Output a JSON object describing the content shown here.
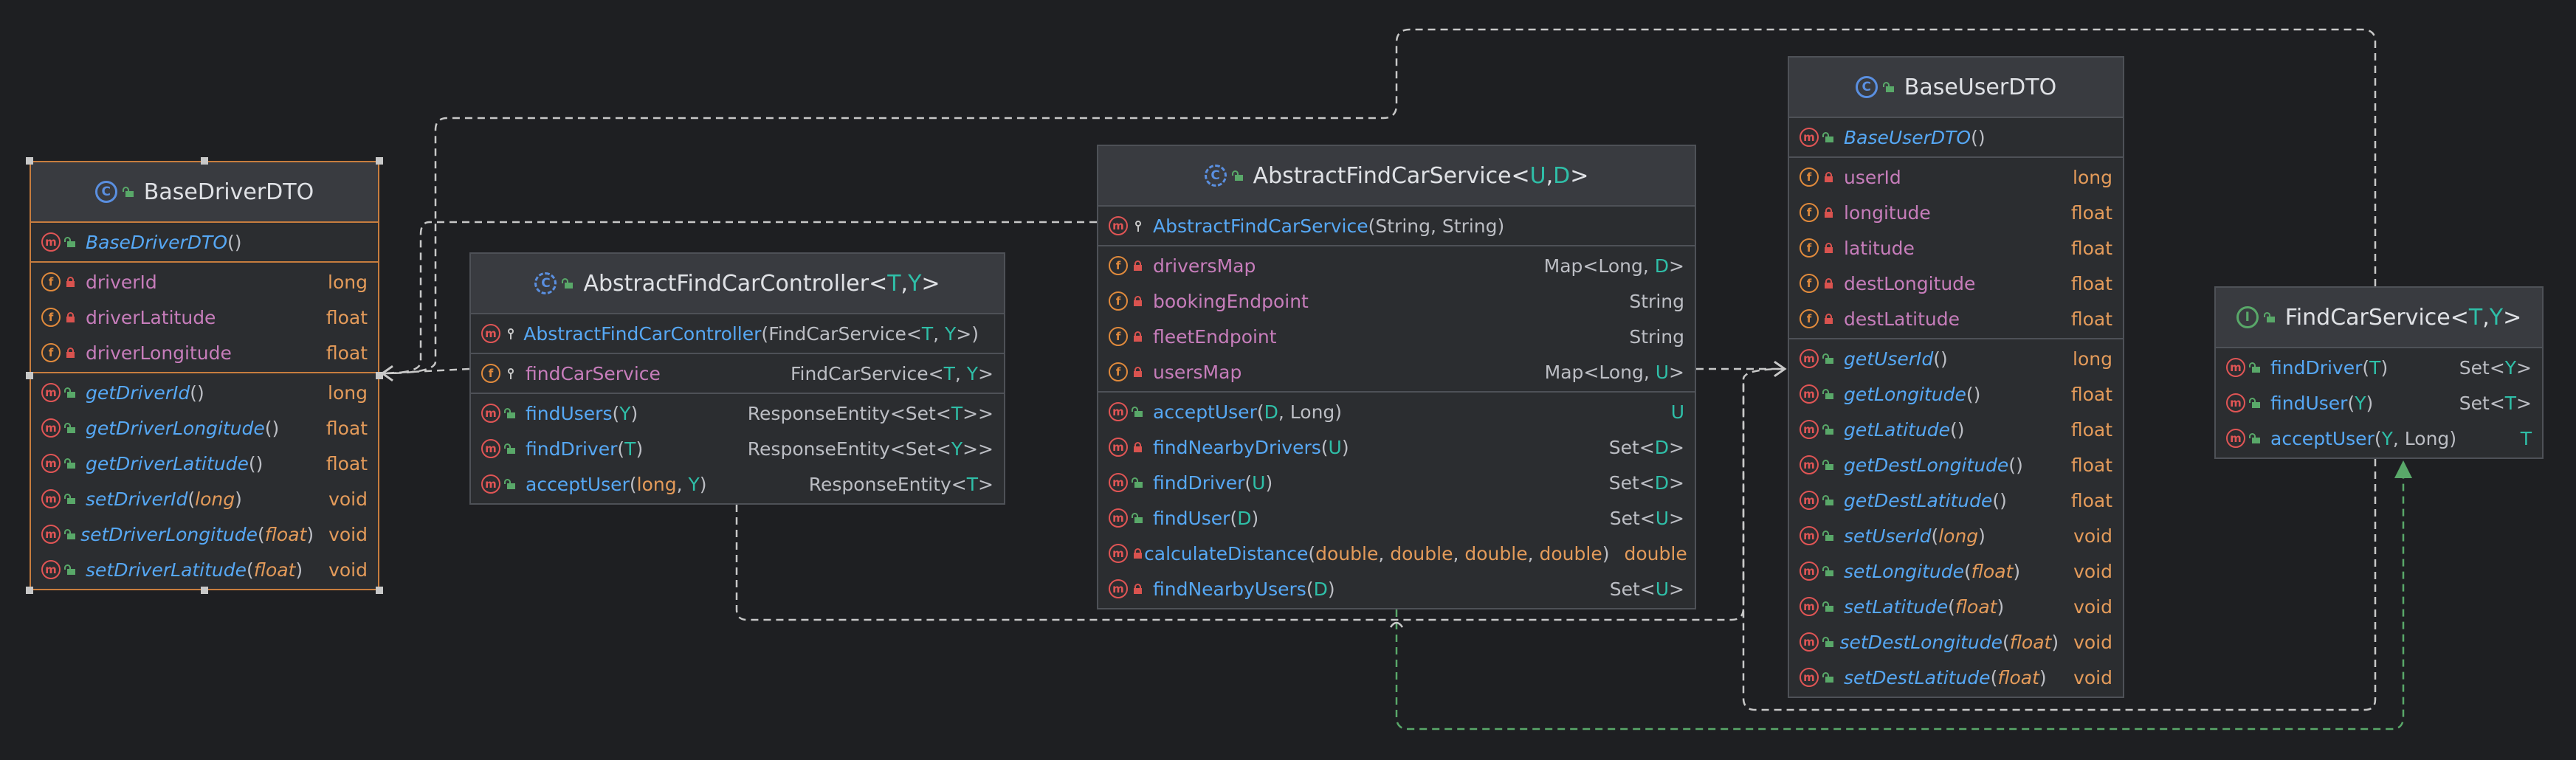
{
  "classes": [
    {
      "id": "BaseDriverDTO",
      "kind": "C",
      "abstract": false,
      "name": "BaseDriverDTO",
      "type_params": [],
      "selected": true,
      "sections": [
        [
          {
            "k": "m",
            "vis": "pub",
            "name": "BaseDriverDTO",
            "style": "ital",
            "params": [],
            "type": ""
          }
        ],
        [
          {
            "k": "f",
            "vis": "priv",
            "name": "driverId",
            "type": "long",
            "prim": true
          },
          {
            "k": "f",
            "vis": "priv",
            "name": "driverLatitude",
            "type": "float",
            "prim": true
          },
          {
            "k": "f",
            "vis": "priv",
            "name": "driverLongitude",
            "type": "float",
            "prim": true
          }
        ],
        [
          {
            "k": "m",
            "vis": "pub",
            "name": "getDriverId",
            "style": "ital",
            "params": [],
            "type": "long",
            "prim": true
          },
          {
            "k": "m",
            "vis": "pub",
            "name": "getDriverLongitude",
            "style": "ital",
            "params": [],
            "type": "float",
            "prim": true
          },
          {
            "k": "m",
            "vis": "pub",
            "name": "getDriverLatitude",
            "style": "ital",
            "params": [],
            "type": "float",
            "prim": true
          },
          {
            "k": "m",
            "vis": "pub",
            "name": "setDriverId",
            "style": "ital",
            "params": [
              {
                "t": "long",
                "c": "pi"
              }
            ],
            "type": "void",
            "prim": true
          },
          {
            "k": "m",
            "vis": "pub",
            "name": "setDriverLongitude",
            "style": "ital",
            "params": [
              {
                "t": "float",
                "c": "pi"
              }
            ],
            "type": "void",
            "prim": true
          },
          {
            "k": "m",
            "vis": "pub",
            "name": "setDriverLatitude",
            "style": "ital",
            "params": [
              {
                "t": "float",
                "c": "pi"
              }
            ],
            "type": "void",
            "prim": true
          }
        ]
      ]
    },
    {
      "id": "AbstractFindCarController",
      "kind": "C",
      "abstract": true,
      "name": "AbstractFindCarController",
      "type_params": [
        "T",
        "Y"
      ],
      "selected": false,
      "sections": [
        [
          {
            "k": "m",
            "vis": "pkg",
            "name": "AbstractFindCarController",
            "params": [
              {
                "t": "FindCarService<",
                "c": "n"
              },
              {
                "t": "T",
                "c": "t"
              },
              {
                "t": ", ",
                "c": "n"
              },
              {
                "t": "Y",
                "c": "t"
              },
              {
                "t": ">",
                "c": "n"
              }
            ],
            "type": ""
          }
        ],
        [
          {
            "k": "f",
            "vis": "pkg",
            "name": "findCarService",
            "type": "",
            "type_rich": [
              {
                "t": "FindCarService<",
                "c": "n"
              },
              {
                "t": "T",
                "c": "t"
              },
              {
                "t": ", ",
                "c": "n"
              },
              {
                "t": "Y",
                "c": "t"
              },
              {
                "t": ">",
                "c": "n"
              }
            ]
          }
        ],
        [
          {
            "k": "m",
            "vis": "pub",
            "name": "findUsers",
            "params": [
              {
                "t": "Y",
                "c": "t"
              }
            ],
            "type": "",
            "type_rich": [
              {
                "t": "ResponseEntity<Set<",
                "c": "n"
              },
              {
                "t": "T",
                "c": "t"
              },
              {
                "t": ">>",
                "c": "n"
              }
            ]
          },
          {
            "k": "m",
            "vis": "pub",
            "name": "findDriver",
            "params": [
              {
                "t": "T",
                "c": "t"
              }
            ],
            "type": "",
            "type_rich": [
              {
                "t": "ResponseEntity<Set<",
                "c": "n"
              },
              {
                "t": "Y",
                "c": "t"
              },
              {
                "t": ">>",
                "c": "n"
              }
            ]
          },
          {
            "k": "m",
            "vis": "pub",
            "name": "acceptUser",
            "params": [
              {
                "t": "long",
                "c": "p"
              },
              {
                "t": ", ",
                "c": "n"
              },
              {
                "t": "Y",
                "c": "t"
              }
            ],
            "type": "",
            "type_rich": [
              {
                "t": "ResponseEntity<",
                "c": "n"
              },
              {
                "t": "T",
                "c": "t"
              },
              {
                "t": ">",
                "c": "n"
              }
            ]
          }
        ]
      ]
    },
    {
      "id": "AbstractFindCarService",
      "kind": "C",
      "abstract": true,
      "name": "AbstractFindCarService",
      "type_params": [
        "U",
        "D"
      ],
      "selected": false,
      "sections": [
        [
          {
            "k": "m",
            "vis": "pkg",
            "name": "AbstractFindCarService",
            "params": [
              {
                "t": "String, String",
                "c": "n"
              }
            ],
            "type": ""
          }
        ],
        [
          {
            "k": "f",
            "vis": "priv",
            "name": "driversMap",
            "type": "",
            "type_rich": [
              {
                "t": "Map<Long, ",
                "c": "n"
              },
              {
                "t": "D",
                "c": "t"
              },
              {
                "t": ">",
                "c": "n"
              }
            ]
          },
          {
            "k": "f",
            "vis": "priv",
            "name": "bookingEndpoint",
            "type": "String"
          },
          {
            "k": "f",
            "vis": "priv",
            "name": "fleetEndpoint",
            "type": "String"
          },
          {
            "k": "f",
            "vis": "priv",
            "name": "usersMap",
            "type": "",
            "type_rich": [
              {
                "t": "Map<Long, ",
                "c": "n"
              },
              {
                "t": "U",
                "c": "t"
              },
              {
                "t": ">",
                "c": "n"
              }
            ]
          }
        ],
        [
          {
            "k": "m",
            "vis": "pub",
            "name": "acceptUser",
            "params": [
              {
                "t": "D",
                "c": "t"
              },
              {
                "t": ", Long",
                "c": "n"
              }
            ],
            "type": "U",
            "tv": true
          },
          {
            "k": "m",
            "vis": "priv",
            "name": "findNearbyDrivers",
            "params": [
              {
                "t": "U",
                "c": "t"
              }
            ],
            "type": "",
            "type_rich": [
              {
                "t": "Set<",
                "c": "n"
              },
              {
                "t": "D",
                "c": "t"
              },
              {
                "t": ">",
                "c": "n"
              }
            ]
          },
          {
            "k": "m",
            "vis": "pub",
            "name": "findDriver",
            "params": [
              {
                "t": "U",
                "c": "t"
              }
            ],
            "type": "",
            "type_rich": [
              {
                "t": "Set<",
                "c": "n"
              },
              {
                "t": "D",
                "c": "t"
              },
              {
                "t": ">",
                "c": "n"
              }
            ]
          },
          {
            "k": "m",
            "vis": "pub",
            "name": "findUser",
            "params": [
              {
                "t": "D",
                "c": "t"
              }
            ],
            "type": "",
            "type_rich": [
              {
                "t": "Set<",
                "c": "n"
              },
              {
                "t": "U",
                "c": "t"
              },
              {
                "t": ">",
                "c": "n"
              }
            ]
          },
          {
            "k": "m",
            "vis": "priv",
            "name": "calculateDistance",
            "params": [
              {
                "t": "double",
                "c": "p"
              },
              {
                "t": ", ",
                "c": "n"
              },
              {
                "t": "double",
                "c": "p"
              },
              {
                "t": ", ",
                "c": "n"
              },
              {
                "t": "double",
                "c": "p"
              },
              {
                "t": ", ",
                "c": "n"
              },
              {
                "t": "double",
                "c": "p"
              }
            ],
            "type": "double",
            "prim": true
          },
          {
            "k": "m",
            "vis": "priv",
            "name": "findNearbyUsers",
            "params": [
              {
                "t": "D",
                "c": "t"
              }
            ],
            "type": "",
            "type_rich": [
              {
                "t": "Set<",
                "c": "n"
              },
              {
                "t": "U",
                "c": "t"
              },
              {
                "t": ">",
                "c": "n"
              }
            ]
          }
        ]
      ]
    },
    {
      "id": "BaseUserDTO",
      "kind": "C",
      "abstract": false,
      "name": "BaseUserDTO",
      "type_params": [],
      "selected": false,
      "sections": [
        [
          {
            "k": "m",
            "vis": "pub",
            "name": "BaseUserDTO",
            "style": "ital",
            "params": [],
            "type": ""
          }
        ],
        [
          {
            "k": "f",
            "vis": "priv",
            "name": "userId",
            "type": "long",
            "prim": true
          },
          {
            "k": "f",
            "vis": "priv",
            "name": "longitude",
            "type": "float",
            "prim": true
          },
          {
            "k": "f",
            "vis": "priv",
            "name": "latitude",
            "type": "float",
            "prim": true
          },
          {
            "k": "f",
            "vis": "priv",
            "name": "destLongitude",
            "type": "float",
            "prim": true
          },
          {
            "k": "f",
            "vis": "priv",
            "name": "destLatitude",
            "type": "float",
            "prim": true
          }
        ],
        [
          {
            "k": "m",
            "vis": "pub",
            "name": "getUserId",
            "style": "ital",
            "params": [],
            "type": "long",
            "prim": true
          },
          {
            "k": "m",
            "vis": "pub",
            "name": "getLongitude",
            "style": "ital",
            "params": [],
            "type": "float",
            "prim": true
          },
          {
            "k": "m",
            "vis": "pub",
            "name": "getLatitude",
            "style": "ital",
            "params": [],
            "type": "float",
            "prim": true
          },
          {
            "k": "m",
            "vis": "pub",
            "name": "getDestLongitude",
            "style": "ital",
            "params": [],
            "type": "float",
            "prim": true
          },
          {
            "k": "m",
            "vis": "pub",
            "name": "getDestLatitude",
            "style": "ital",
            "params": [],
            "type": "float",
            "prim": true
          },
          {
            "k": "m",
            "vis": "pub",
            "name": "setUserId",
            "style": "ital",
            "params": [
              {
                "t": "long",
                "c": "pi"
              }
            ],
            "type": "void",
            "prim": true
          },
          {
            "k": "m",
            "vis": "pub",
            "name": "setLongitude",
            "style": "ital",
            "params": [
              {
                "t": "float",
                "c": "pi"
              }
            ],
            "type": "void",
            "prim": true
          },
          {
            "k": "m",
            "vis": "pub",
            "name": "setLatitude",
            "style": "ital",
            "params": [
              {
                "t": "float",
                "c": "pi"
              }
            ],
            "type": "void",
            "prim": true
          },
          {
            "k": "m",
            "vis": "pub",
            "name": "setDestLongitude",
            "style": "ital",
            "params": [
              {
                "t": "float",
                "c": "pi"
              }
            ],
            "type": "void",
            "prim": true
          },
          {
            "k": "m",
            "vis": "pub",
            "name": "setDestLatitude",
            "style": "ital",
            "params": [
              {
                "t": "float",
                "c": "pi"
              }
            ],
            "type": "void",
            "prim": true
          }
        ]
      ]
    },
    {
      "id": "FindCarService",
      "kind": "I",
      "abstract": false,
      "name": "FindCarService",
      "type_params": [
        "T",
        "Y"
      ],
      "selected": false,
      "sections": [
        [
          {
            "k": "m",
            "vis": "pub",
            "name": "findDriver",
            "params": [
              {
                "t": "T",
                "c": "t"
              }
            ],
            "type": "",
            "type_rich": [
              {
                "t": "Set<",
                "c": "n"
              },
              {
                "t": "Y",
                "c": "t"
              },
              {
                "t": ">",
                "c": "n"
              }
            ]
          },
          {
            "k": "m",
            "vis": "pub",
            "name": "findUser",
            "params": [
              {
                "t": "Y",
                "c": "t"
              }
            ],
            "type": "",
            "type_rich": [
              {
                "t": "Set<",
                "c": "n"
              },
              {
                "t": "T",
                "c": "t"
              },
              {
                "t": ">",
                "c": "n"
              }
            ]
          },
          {
            "k": "m",
            "vis": "pub",
            "name": "acceptUser",
            "params": [
              {
                "t": "Y",
                "c": "t"
              },
              {
                "t": ", Long",
                "c": "n"
              }
            ],
            "type": "T",
            "tv": true
          }
        ]
      ]
    }
  ],
  "edges": [
    {
      "from": "AbstractFindCarController",
      "to": "BaseDriverDTO",
      "style": "dashed",
      "arrow": "open",
      "color": "#c8c8c8"
    },
    {
      "from": "AbstractFindCarService",
      "to": "BaseDriverDTO",
      "style": "dashed",
      "arrow": "open",
      "color": "#c8c8c8"
    },
    {
      "from": "AbstractFindCarService",
      "to": "BaseUserDTO",
      "style": "dashed",
      "arrow": "open",
      "color": "#c8c8c8"
    },
    {
      "from": "FindCarService",
      "to": "BaseDriverDTO",
      "style": "dashed",
      "arrow": "none",
      "color": "#c8c8c8"
    },
    {
      "from": "FindCarService",
      "to": "BaseUserDTO",
      "style": "dashed",
      "arrow": "none",
      "color": "#c8c8c8"
    },
    {
      "from": "AbstractFindCarService",
      "to": "FindCarService",
      "style": "dashed",
      "arrow": "realization",
      "color": "#59a869"
    }
  ],
  "colors": {
    "background": "#1e1f22",
    "node": "#2b2d30",
    "header": "#393b40",
    "selection": "#c77d3e",
    "method_badge": "#e05555",
    "field_badge": "#e08a3c",
    "type_var": "#2fbfa8",
    "interface": "#59a869"
  }
}
